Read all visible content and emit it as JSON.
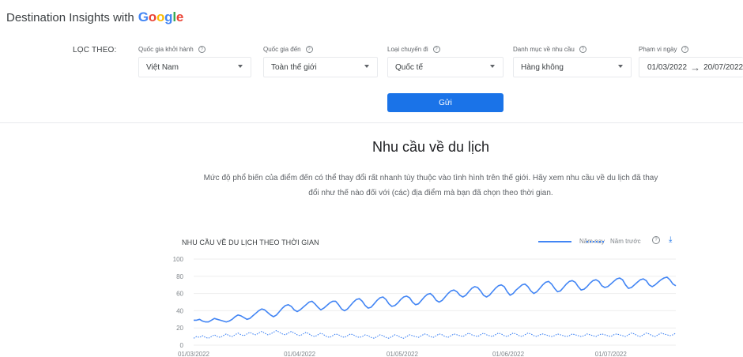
{
  "header": {
    "brand_text": "Destination Insights with",
    "brand_logo": "Google",
    "logo_colors": [
      "#4285F4",
      "#EA4335",
      "#FBBC05",
      "#4285F4",
      "#34A853",
      "#EA4335"
    ]
  },
  "filters": {
    "label": "LỌC THEO:",
    "origin": {
      "title": "Quốc gia khởi hành",
      "value": "Việt Nam"
    },
    "destination": {
      "title": "Quốc gia đến",
      "value": "Toàn thế giới"
    },
    "trip_type": {
      "title": "Loại chuyến đi",
      "value": "Quốc tế"
    },
    "category": {
      "title": "Danh mục về nhu cầu",
      "value": "Hàng không"
    },
    "date_range": {
      "title": "Phạm vi ngày",
      "start": "01/03/2022",
      "end": "20/07/2022"
    },
    "submit_label": "Gửi"
  },
  "section": {
    "title": "Nhu cầu về du lịch",
    "description": "Mức độ phổ biến của điểm đến có thể thay đổi rất nhanh tùy thuộc vào tình hình trên thế giới. Hãy xem nhu cầu về du lịch đã thay đổi như thế nào đối với (các) địa điểm mà bạn đã chọn theo thời gian."
  },
  "chart_header": {
    "title": "NHU CẦU VỀ DU LỊCH THEO THỜI GIAN",
    "legend_this_year": "Năm nay",
    "legend_last_year": "Năm trước",
    "accent_color": "#4285f4"
  },
  "chart_data": {
    "type": "line",
    "ylim": [
      0,
      100
    ],
    "yticks": [
      0,
      20,
      40,
      60,
      80,
      100
    ],
    "xticks": [
      "01/03/2022",
      "01/04/2022",
      "01/05/2022",
      "01/06/2022",
      "01/07/2022"
    ],
    "x_start": "01/03/2022",
    "x_end": "20/07/2022",
    "series": [
      {
        "name": "Năm nay",
        "style": "solid",
        "values": [
          29,
          29,
          30,
          28,
          27,
          27,
          29,
          31,
          30,
          29,
          28,
          27,
          28,
          30,
          33,
          35,
          34,
          32,
          30,
          31,
          34,
          37,
          40,
          42,
          41,
          38,
          35,
          33,
          35,
          39,
          43,
          46,
          47,
          45,
          41,
          39,
          41,
          44,
          47,
          50,
          51,
          48,
          44,
          41,
          43,
          46,
          49,
          51,
          51,
          47,
          42,
          40,
          42,
          46,
          50,
          53,
          54,
          51,
          46,
          43,
          44,
          48,
          52,
          55,
          56,
          53,
          48,
          45,
          46,
          49,
          53,
          56,
          57,
          55,
          50,
          47,
          48,
          52,
          56,
          59,
          60,
          57,
          52,
          50,
          52,
          56,
          60,
          63,
          64,
          62,
          58,
          56,
          58,
          62,
          66,
          68,
          67,
          63,
          58,
          56,
          58,
          62,
          66,
          69,
          70,
          68,
          62,
          58,
          60,
          64,
          67,
          70,
          71,
          68,
          63,
          60,
          62,
          66,
          70,
          73,
          74,
          71,
          66,
          62,
          63,
          67,
          71,
          74,
          75,
          73,
          68,
          64,
          65,
          68,
          72,
          75,
          76,
          74,
          69,
          67,
          68,
          71,
          74,
          77,
          78,
          76,
          70,
          66,
          67,
          70,
          73,
          76,
          77,
          75,
          70,
          68,
          70,
          73,
          76,
          78,
          79,
          76,
          71,
          69
        ]
      },
      {
        "name": "Năm trước",
        "style": "dotted",
        "values": [
          8,
          10,
          9,
          11,
          9,
          8,
          10,
          12,
          10,
          9,
          11,
          13,
          11,
          10,
          12,
          14,
          12,
          11,
          13,
          15,
          13,
          12,
          14,
          16,
          14,
          12,
          13,
          15,
          17,
          15,
          13,
          12,
          14,
          16,
          14,
          12,
          11,
          13,
          15,
          13,
          11,
          10,
          12,
          14,
          12,
          10,
          9,
          11,
          13,
          12,
          10,
          9,
          11,
          13,
          12,
          10,
          9,
          10,
          12,
          11,
          9,
          8,
          10,
          12,
          11,
          9,
          8,
          10,
          12,
          11,
          9,
          8,
          10,
          12,
          11,
          10,
          9,
          11,
          13,
          12,
          10,
          9,
          11,
          13,
          12,
          10,
          9,
          11,
          13,
          12,
          11,
          10,
          12,
          14,
          12,
          11,
          10,
          12,
          14,
          12,
          11,
          10,
          12,
          14,
          13,
          11,
          10,
          12,
          14,
          13,
          11,
          10,
          12,
          14,
          13,
          11,
          10,
          12,
          13,
          12,
          11,
          10,
          11,
          13,
          12,
          11,
          10,
          11,
          13,
          12,
          11,
          10,
          11,
          13,
          12,
          11,
          10,
          12,
          13,
          12,
          11,
          10,
          12,
          13,
          12,
          11,
          10,
          12,
          14,
          13,
          11,
          10,
          12,
          14,
          13,
          11,
          10,
          12,
          14,
          13,
          12,
          11,
          12,
          14
        ]
      }
    ]
  }
}
